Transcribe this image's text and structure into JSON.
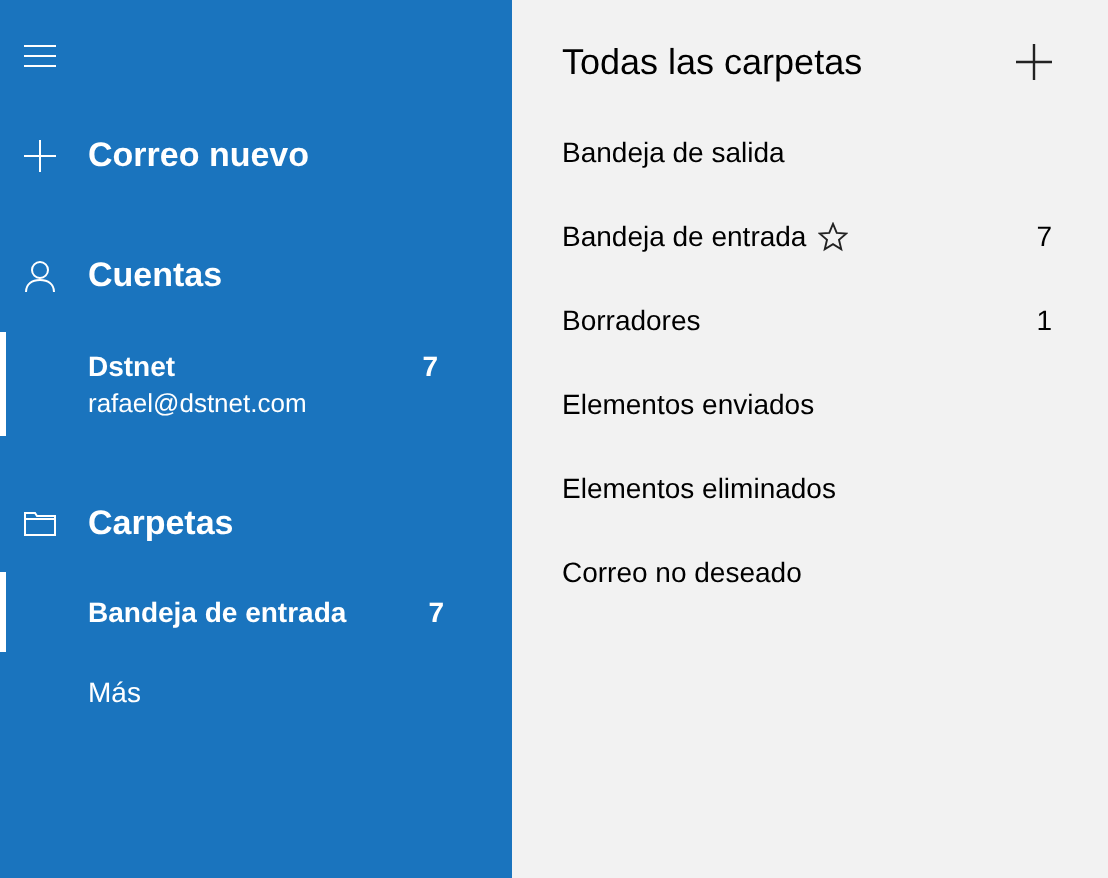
{
  "sidebar": {
    "new_mail": "Correo nuevo",
    "accounts_heading": "Cuentas",
    "accounts": [
      {
        "name": "Dstnet",
        "email": "rafael@dstnet.com",
        "count": "7",
        "selected": true
      }
    ],
    "folders_heading": "Carpetas",
    "folders": [
      {
        "label": "Bandeja de entrada",
        "count": "7",
        "selected": true
      },
      {
        "label": "Más",
        "selected": false
      }
    ]
  },
  "folder_pane": {
    "title": "Todas las carpetas",
    "folders": [
      {
        "label": "Bandeja de salida",
        "favorite": false
      },
      {
        "label": "Bandeja de entrada",
        "favorite": true,
        "count": "7"
      },
      {
        "label": "Borradores",
        "favorite": false,
        "count": "1"
      },
      {
        "label": "Elementos enviados",
        "favorite": false
      },
      {
        "label": "Elementos eliminados",
        "favorite": false
      },
      {
        "label": "Correo no deseado",
        "favorite": false
      }
    ]
  }
}
